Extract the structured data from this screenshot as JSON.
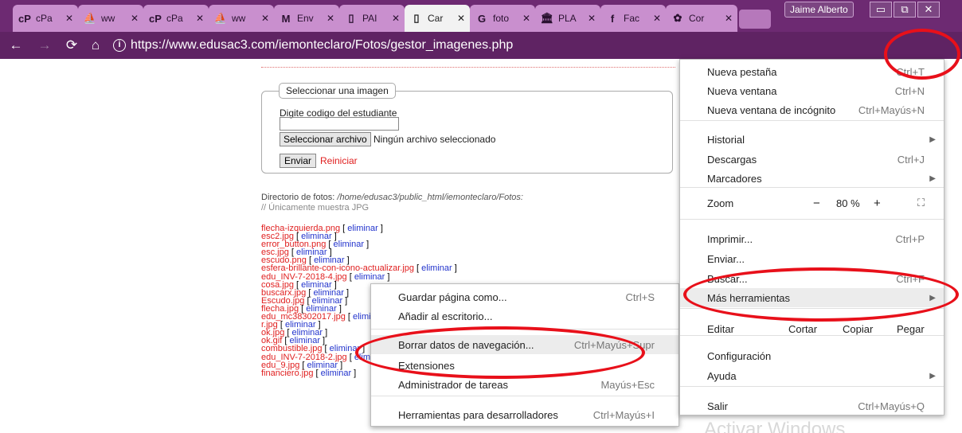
{
  "tabs": [
    {
      "label": "cPa",
      "icon": "cpanel-icon",
      "glyph": "cP",
      "active": false
    },
    {
      "label": "ww",
      "icon": "phpmyadmin-icon",
      "glyph": "⛵",
      "active": false
    },
    {
      "label": "cPa",
      "icon": "cpanel-icon",
      "glyph": "cP",
      "active": false
    },
    {
      "label": "ww",
      "icon": "phpmyadmin-icon",
      "glyph": "⛵",
      "active": false
    },
    {
      "label": "Env",
      "icon": "gmail-icon",
      "glyph": "M",
      "active": false
    },
    {
      "label": "PAI",
      "icon": "document-icon",
      "glyph": "▯",
      "active": false
    },
    {
      "label": "Car",
      "icon": "document-icon",
      "glyph": "▯",
      "active": true
    },
    {
      "label": "foto",
      "icon": "google-icon",
      "glyph": "G",
      "active": false
    },
    {
      "label": "PLA",
      "icon": "bank-icon",
      "glyph": "🏛",
      "active": false
    },
    {
      "label": "Fac",
      "icon": "facebook-icon",
      "glyph": "f",
      "active": false
    },
    {
      "label": "Cor",
      "icon": "settings-icon",
      "glyph": "✿",
      "active": false
    }
  ],
  "window": {
    "user": "Jaime Alberto",
    "minimize": "▭",
    "maximize": "⧉",
    "close": "✕"
  },
  "toolbar": {
    "url": "https://www.edusac3.com/iemonteclaro/Fotos/gestor_imagenes.php",
    "info": "i"
  },
  "form": {
    "legend": "Seleccionar una imagen",
    "code_label": "Digite codigo del estudiante",
    "file_button": "Seleccionar archivo",
    "file_status": "Ningún archivo seleccionado",
    "send": "Enviar",
    "reset": "Reiniciar"
  },
  "directory": {
    "label": "Directorio de fotos:",
    "path": "/home/edusac3/public_html/iemonteclaro/Fotos:",
    "note": "// Únicamente muestra JPG"
  },
  "files": [
    "flecha-izquierda.png",
    "esc2.jpg",
    "error_button.png",
    "esc.jpg",
    "escudo.png",
    "esfera-brillante-con-icono-actualizar.jpg",
    "edu_INV-7-2018-4.jpg",
    "cosa.jpg",
    "buscarx.jpg",
    "Escudo.jpg",
    "flecha.jpg",
    "edu_mc38302017.jpg",
    "r.jpg",
    "ok.jpg",
    "ok.gif",
    "combustible.jpg",
    "edu_INV-7-2018-2.jpg",
    "edu_9.jpg",
    "financiero.jpg"
  ],
  "delete_label": "eliminar",
  "menu": {
    "items": [
      {
        "label": "Nueva pestaña",
        "shortcut": "Ctrl+T"
      },
      {
        "label": "Nueva ventana",
        "shortcut": "Ctrl+N"
      },
      {
        "label": "Nueva ventana de incógnito",
        "shortcut": "Ctrl+Mayús+N"
      },
      {
        "label": "Historial",
        "shortcut": ""
      },
      {
        "label": "Descargas",
        "shortcut": "Ctrl+J"
      },
      {
        "label": "Marcadores",
        "shortcut": ""
      },
      {
        "label": "Imprimir...",
        "shortcut": "Ctrl+P"
      },
      {
        "label": "Enviar...",
        "shortcut": ""
      },
      {
        "label": "Buscar...",
        "shortcut": "Ctrl+F"
      },
      {
        "label": "Más herramientas",
        "shortcut": ""
      },
      {
        "label": "Configuración",
        "shortcut": ""
      },
      {
        "label": "Ayuda",
        "shortcut": ""
      },
      {
        "label": "Salir",
        "shortcut": "Ctrl+Mayús+Q"
      }
    ],
    "zoom": {
      "label": "Zoom",
      "minus": "−",
      "value": "80 %",
      "plus": "+"
    },
    "edit": {
      "label": "Editar",
      "cut": "Cortar",
      "copy": "Copiar",
      "paste": "Pegar"
    }
  },
  "submenu": {
    "items": [
      {
        "label": "Guardar página como...",
        "shortcut": "Ctrl+S"
      },
      {
        "label": "Añadir al escritorio...",
        "shortcut": ""
      },
      {
        "label": "Borrar datos de navegación...",
        "shortcut": "Ctrl+Mayús+Supr"
      },
      {
        "label": "Extensiones",
        "shortcut": ""
      },
      {
        "label": "Administrador de tareas",
        "shortcut": "Mayús+Esc"
      },
      {
        "label": "Herramientas para desarrolladores",
        "shortcut": "Ctrl+Mayús+I"
      }
    ]
  },
  "watermark": "Activar Windows",
  "colors": {
    "tabstrip": "#6d2a72",
    "toolbar": "#5f2363",
    "annotation": "#e8101a",
    "link_red": "#e02020",
    "link_blue": "#2233cc"
  }
}
